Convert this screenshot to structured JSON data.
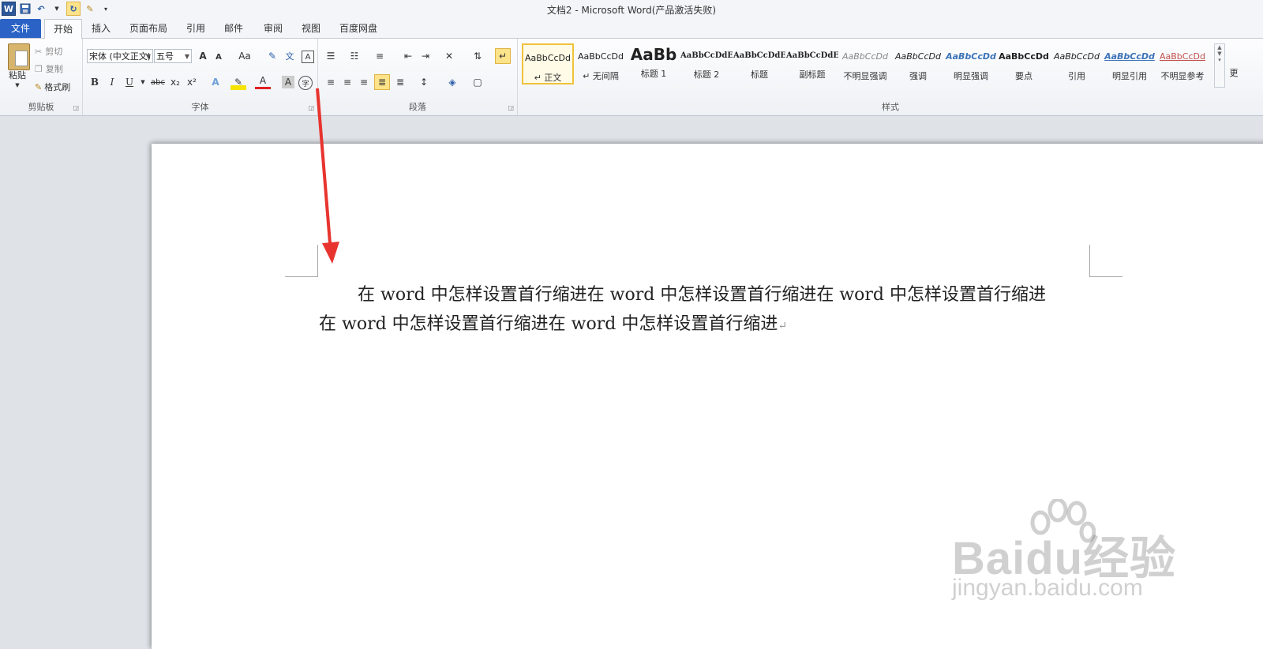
{
  "window": {
    "title": "文档2 - Microsoft Word(产品激活失败)"
  },
  "quick_access": {
    "logo": "W",
    "items": [
      "save-icon",
      "undo-icon",
      "redo-icon",
      "format-painter-icon",
      "customize-icon"
    ]
  },
  "tabs": [
    {
      "label": "文件"
    },
    {
      "label": "开始"
    },
    {
      "label": "插入"
    },
    {
      "label": "页面布局"
    },
    {
      "label": "引用"
    },
    {
      "label": "邮件"
    },
    {
      "label": "审阅"
    },
    {
      "label": "视图"
    },
    {
      "label": "百度网盘"
    }
  ],
  "clipboard": {
    "paste": "粘贴",
    "cut": "剪切",
    "copy": "复制",
    "format_painter": "格式刷",
    "group_label": "剪贴板"
  },
  "font": {
    "name": "宋体 (中文正文)",
    "size": "五号",
    "group_label": "字体",
    "buttons": [
      "A",
      "A",
      "Aa",
      "B",
      "I",
      "U",
      "abc",
      "x₂",
      "x²",
      "A",
      "A",
      "A",
      "字"
    ]
  },
  "paragraph": {
    "group_label": "段落"
  },
  "styles": {
    "group_label": "样式",
    "items": [
      {
        "sample": "AaBbCcDd",
        "name": "↵ 正文"
      },
      {
        "sample": "AaBbCcDd",
        "name": "↵ 无间隔"
      },
      {
        "sample": "AaBb",
        "name": "标题 1"
      },
      {
        "sample": "AaBbCcDdEe",
        "name": "标题 2"
      },
      {
        "sample": "AaBbCcDdEe",
        "name": "标题"
      },
      {
        "sample": "AaBbCcDdEe",
        "name": "副标题"
      },
      {
        "sample": "AaBbCcDd",
        "name": "不明显强调"
      },
      {
        "sample": "AaBbCcDd",
        "name": "强调"
      },
      {
        "sample": "AaBbCcDd",
        "name": "明显强调"
      },
      {
        "sample": "AaBbCcDd",
        "name": "要点"
      },
      {
        "sample": "AaBbCcDd",
        "name": "引用"
      },
      {
        "sample": "AaBbCcDd",
        "name": "明显引用"
      },
      {
        "sample": "AaBbCcDd",
        "name": "不明显参考"
      }
    ],
    "more": "更"
  },
  "document": {
    "line1": "在 word 中怎样设置首行缩进在 word 中怎样设置首行缩进在 word 中怎样设置首行缩进",
    "line2": "在 word 中怎样设置首行缩进在 word 中怎样设置首行缩进",
    "para_mark": "↵"
  },
  "watermark": {
    "main": "Baidu经验",
    "sub": "jingyan.baidu.com"
  },
  "colors": {
    "file_tab": "#2a63c5",
    "selected_style": "#f0c23b",
    "arrow": "#e8342f"
  }
}
